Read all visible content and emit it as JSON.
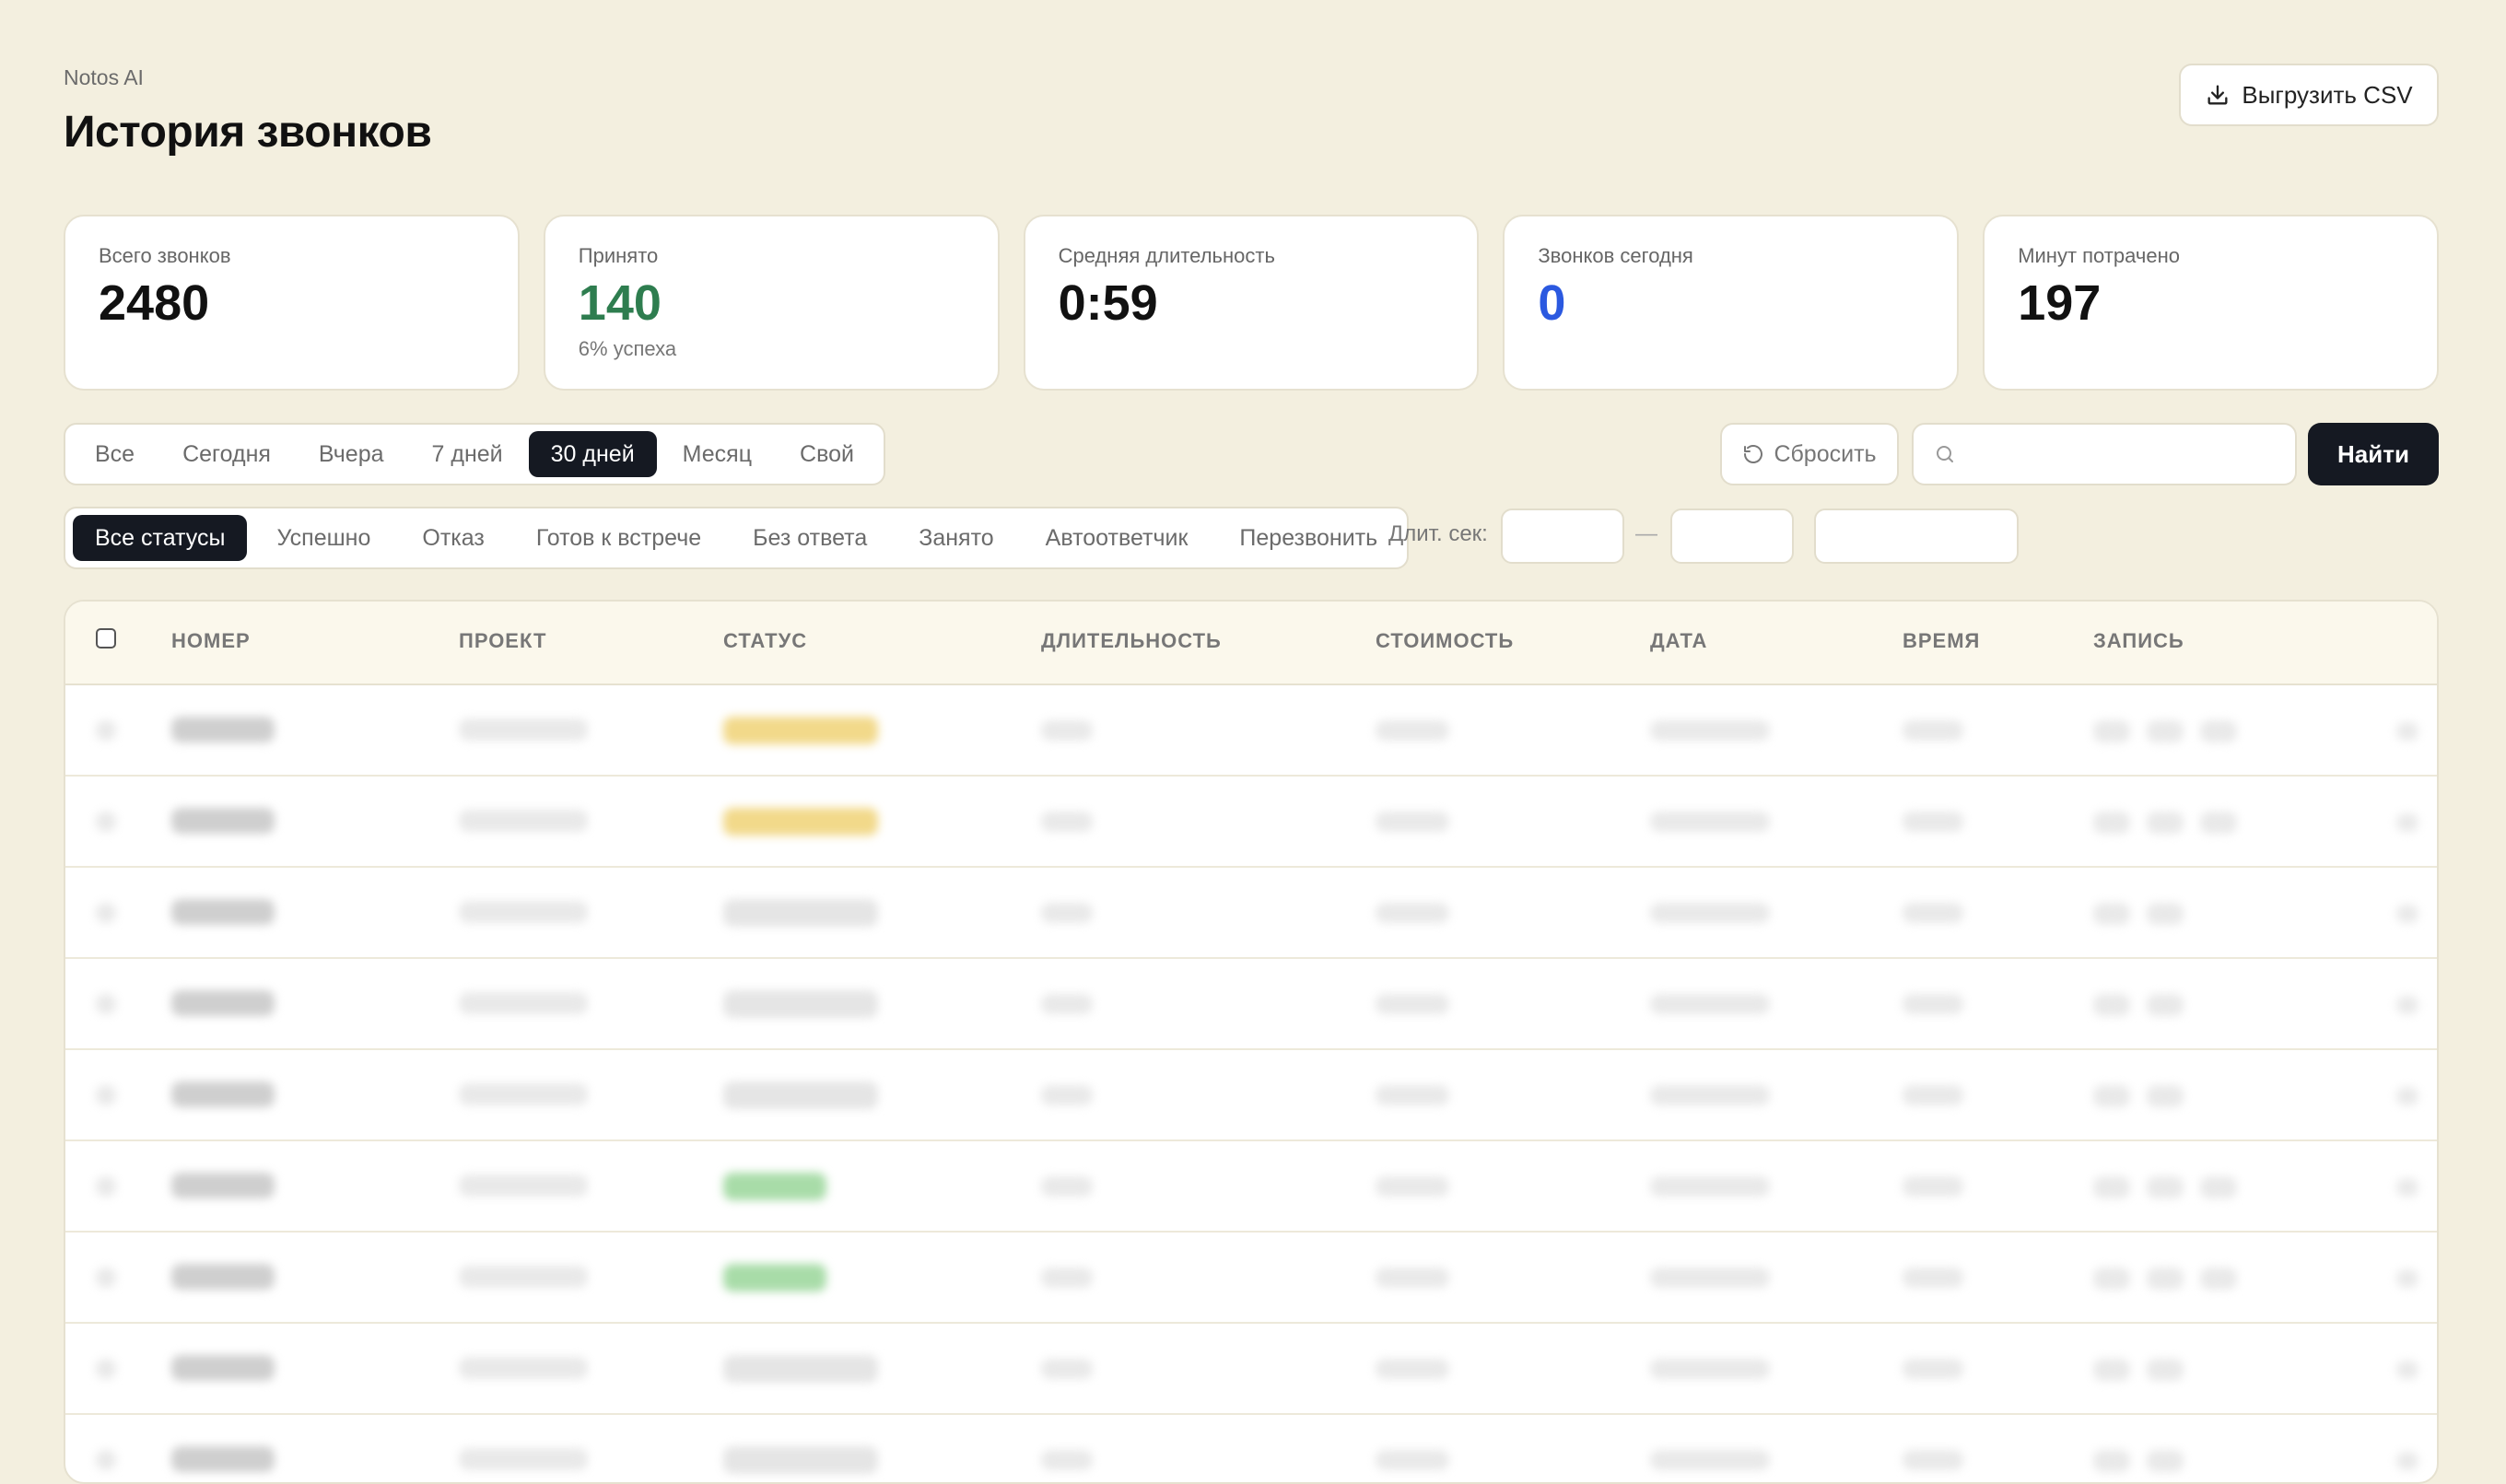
{
  "app": {
    "name": "Notos AI",
    "title": "История звонков",
    "export_label": "Выгрузить CSV"
  },
  "stats": [
    {
      "label": "Всего звонков",
      "value": "2480",
      "sub": "",
      "color": "#111111"
    },
    {
      "label": "Принято",
      "value": "140",
      "sub": "6% успеха",
      "color": "#2e7d4f"
    },
    {
      "label": "Средняя длительность",
      "value": "0:59",
      "sub": "",
      "color": "#111111"
    },
    {
      "label": "Звонков сегодня",
      "value": "0",
      "sub": "",
      "color": "#2b59e0"
    },
    {
      "label": "Минут потрачено",
      "value": "197",
      "sub": "",
      "color": "#111111"
    }
  ],
  "period_tabs": {
    "items": [
      "Все",
      "Сегодня",
      "Вчера",
      "7 дней",
      "30 дней",
      "Месяц",
      "Свой"
    ],
    "active": "30 дней"
  },
  "search": {
    "reset_label": "Сбросить",
    "placeholder": "",
    "value": "",
    "find_label": "Найти"
  },
  "status_tabs": {
    "items": [
      "Все статусы",
      "Успешно",
      "Отказ",
      "Готов к встрече",
      "Без ответа",
      "Занято",
      "Автоответчик",
      "Перезвонить"
    ],
    "active": "Все статусы"
  },
  "duration_filter": {
    "label": "Длит. сек:",
    "separator": "—",
    "min_value": "",
    "max_value": "",
    "extra_value": ""
  },
  "table": {
    "columns": [
      "НОМЕР",
      "ПРОЕКТ",
      "СТАТУС",
      "ДЛИТЕЛЬНОСТЬ",
      "СТОИМОСТЬ",
      "ДАТА",
      "ВРЕМЯ",
      "ЗАПИСЬ"
    ],
    "rows": [
      {
        "status_color": "#f2d98a",
        "record_items": 3
      },
      {
        "status_color": "#f2d98a",
        "record_items": 3
      },
      {
        "status_color": "#e5e5e5",
        "record_items": 2
      },
      {
        "status_color": "#e5e5e5",
        "record_items": 2
      },
      {
        "status_color": "#e5e5e5",
        "record_items": 2
      },
      {
        "status_color": "#a8dca8",
        "record_items": 3
      },
      {
        "status_color": "#a8dca8",
        "record_items": 3
      },
      {
        "status_color": "#e5e5e5",
        "record_items": 2
      },
      {
        "status_color": "#e5e5e5",
        "record_items": 2
      }
    ]
  },
  "colors": {
    "background": "#f3efdf",
    "dark_button": "#151922",
    "accepted_green": "#2e7d4f",
    "today_blue": "#2b59e0"
  }
}
